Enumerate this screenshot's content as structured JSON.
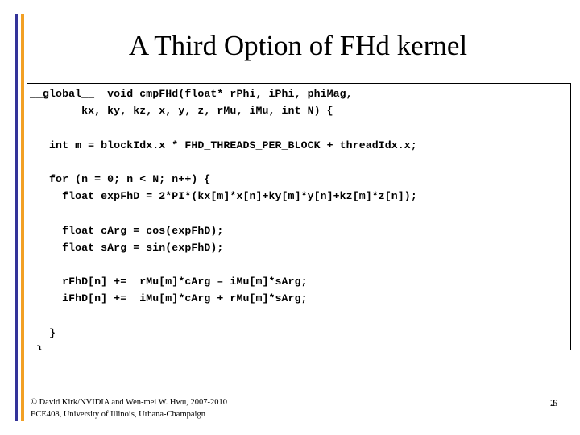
{
  "slide": {
    "title": "A Third Option of FHd kernel",
    "page_number": "26"
  },
  "theme": {
    "accent_blue": "#333399",
    "accent_orange": "#F2A024",
    "text_color": "#000000",
    "background": "#FFFFFF"
  },
  "code_block": {
    "language": "cuda-c",
    "lines": [
      "__global__  void cmpFHd(float* rPhi, iPhi, phiMag,",
      "        kx, ky, kz, x, y, z, rMu, iMu, int N) {",
      "",
      "   int m = blockIdx.x * FHD_THREADS_PER_BLOCK + threadIdx.x;",
      "",
      "   for (n = 0; n < N; n++) {",
      "     float expFhD = 2*PI*(kx[m]*x[n]+ky[m]*y[n]+kz[m]*z[n]);",
      "",
      "     float cArg = cos(expFhD);",
      "     float sArg = sin(expFhD);",
      "",
      "     rFhD[n] +=  rMu[m]*cArg – iMu[m]*sArg;",
      "     iFhD[n] +=  iMu[m]*cArg + rMu[m]*sArg;",
      "",
      "   }",
      " }"
    ]
  },
  "footer": {
    "line1": "© David Kirk/NVIDIA and Wen-mei W. Hwu, 2007-2010",
    "line2": "ECE408, University of Illinois, Urbana-Champaign"
  }
}
